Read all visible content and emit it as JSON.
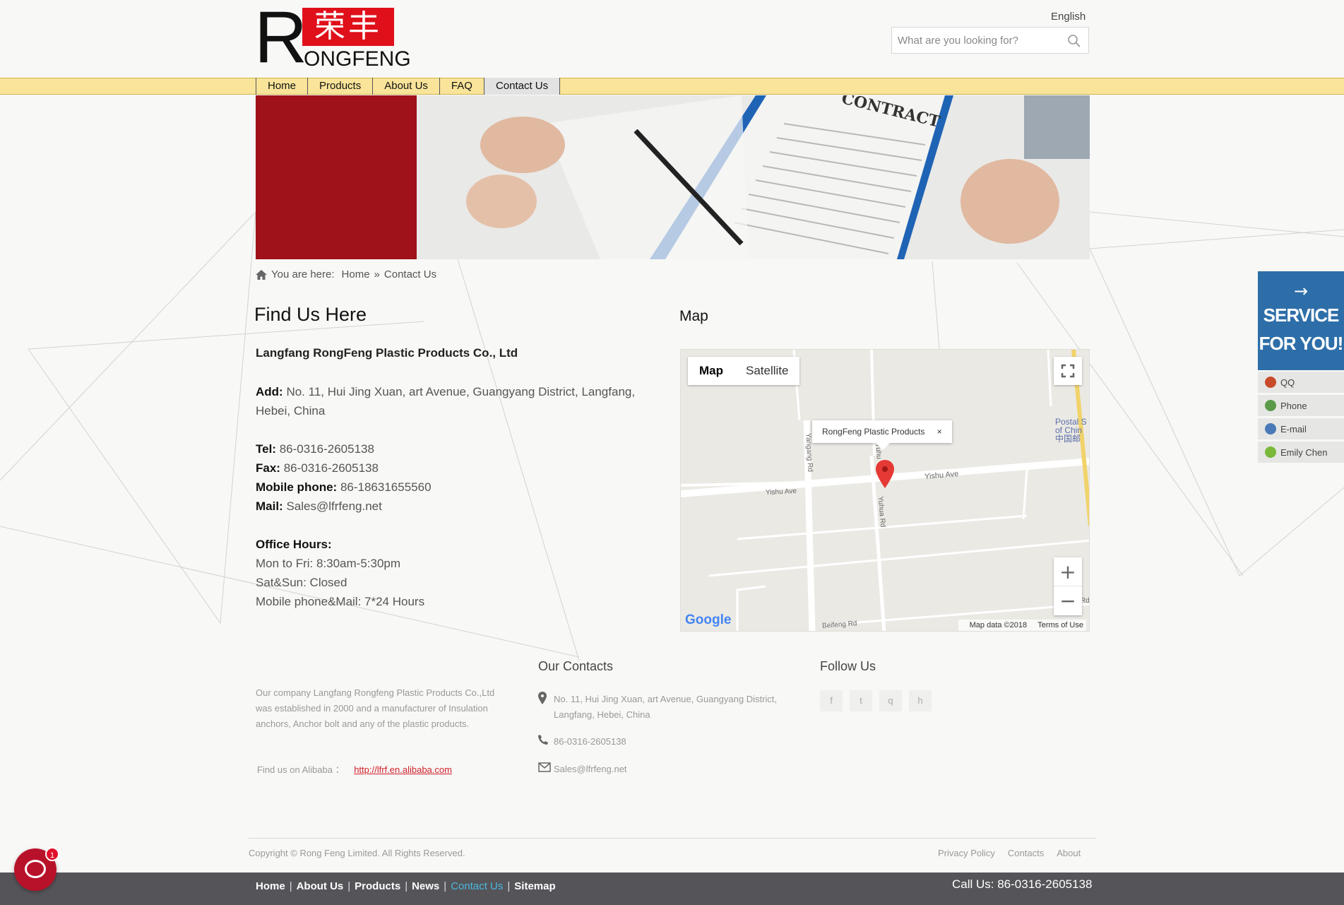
{
  "header": {
    "logo_char": "R",
    "logo_chinese": "荣丰",
    "logo_brand": "ONGFENG",
    "language": "English",
    "search_placeholder": "What are you looking for?"
  },
  "nav": {
    "items": [
      "Home",
      "Products",
      "About Us",
      "FAQ",
      "Contact Us"
    ],
    "active": "Contact Us"
  },
  "banner": {
    "contract_text": "CONTRACT"
  },
  "breadcrumb": {
    "prefix": "You are here:",
    "home": "Home",
    "separator": "»",
    "current": "Contact Us"
  },
  "contact": {
    "title": "Find Us Here",
    "company": "Langfang RongFeng Plastic Products Co., Ltd",
    "add_label": "Add:",
    "add_value": "No. 11, Hui Jing Xuan, art Avenue, Guangyang District, Langfang, Hebei, China",
    "tel_label": "Tel:",
    "tel_value": "86-0316-2605138",
    "fax_label": "Fax:",
    "fax_value": "86-0316-2605138",
    "mobile_label": "Mobile phone:",
    "mobile_value": "86-18631655560",
    "mail_label": "Mail:",
    "mail_value": "Sales@lfrfeng.net",
    "hours_label": "Office Hours:",
    "hours_1": "Mon to Fri: 8:30am-5:30pm",
    "hours_2": "Sat&Sun: Closed",
    "hours_3": "Mobile phone&Mail: 7*24 Hours"
  },
  "map": {
    "title": "Map",
    "type_map": "Map",
    "type_satellite": "Satellite",
    "info_label": "RongFeng Plastic Products",
    "info_close": "×",
    "zoom_in": "+",
    "zoom_out": "−",
    "google": "Google",
    "map_data": "Map data ©2018",
    "terms": "Terms of Use",
    "road_yishu": "Yishu Ave",
    "road_yishu_left": "Yishu Ave",
    "road_yangang": "Yangang Rd",
    "road_yuhua": "Yuhua Rd",
    "road_yuhua_top": "Yuhu",
    "road_beifeng": "Beifeng Rd",
    "road_rd": "Rd",
    "postal_1": "Postal S",
    "postal_2": "of Chin",
    "postal_3": "中国邮"
  },
  "service": {
    "arrow": "→",
    "title_1": "SERVICE",
    "title_2": "FOR YOU!",
    "items": [
      "QQ",
      "Phone",
      "E-mail",
      "Emily Chen"
    ],
    "item_colors": [
      "#c94a2a",
      "#5a9a48",
      "#4a7ab8",
      "#7ab83a"
    ]
  },
  "footer": {
    "about": "Our company Langfang Rongfeng Plastic Products Co.,Ltd was established in 2000 and a manufacturer of Insulation anchors, Anchor bolt and any of the plastic products.",
    "alibaba_label": "Find us on Alibaba ：",
    "alibaba_link": "http://lfrf.en.alibaba.com",
    "contacts_title": "Our Contacts",
    "address": "No. 11, Hui Jing Xuan, art Avenue, Guangyang District, Langfang, Hebei, China",
    "phone": "86-0316-2605138",
    "email": "Sales@lfrfeng.net",
    "follow_title": "Follow Us",
    "social": [
      "f",
      "t",
      "q",
      "h"
    ],
    "copyright": "Copyright © Rong Feng Limited. All Rights Reserved.",
    "links": [
      "Privacy Policy",
      "Contacts",
      "About"
    ],
    "bottom_nav": [
      "Home",
      "About Us",
      "Products",
      "News",
      "Contact Us",
      "Sitemap"
    ],
    "bottom_current": "Contact Us",
    "bottom_sep": "|",
    "call_us": "Call Us: 86-0316-2605138",
    "chat_badge": "1"
  }
}
